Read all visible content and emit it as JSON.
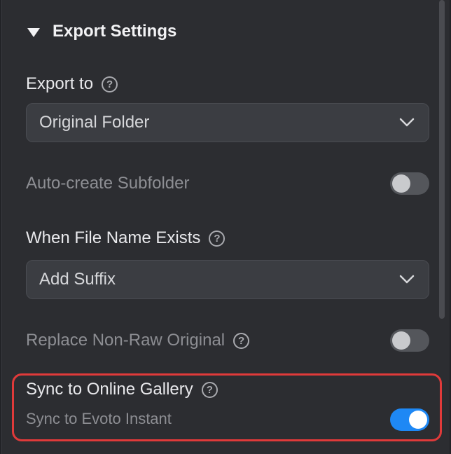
{
  "section": {
    "title": "Export Settings"
  },
  "export_to": {
    "label": "Export to",
    "selected": "Original Folder"
  },
  "auto_subfolder": {
    "label": "Auto-create Subfolder",
    "enabled": false
  },
  "file_exists": {
    "label": "When File Name Exists",
    "selected": "Add Suffix"
  },
  "replace_original": {
    "label": "Replace Non-Raw Original",
    "enabled": false
  },
  "sync": {
    "label": "Sync to Online Gallery",
    "sublabel": "Sync to Evoto Instant",
    "enabled": true
  },
  "colors": {
    "accent": "#1e88f5",
    "highlight": "#e03a3a",
    "panel_bg": "#2c2d31"
  },
  "icons": {
    "help": "?"
  }
}
